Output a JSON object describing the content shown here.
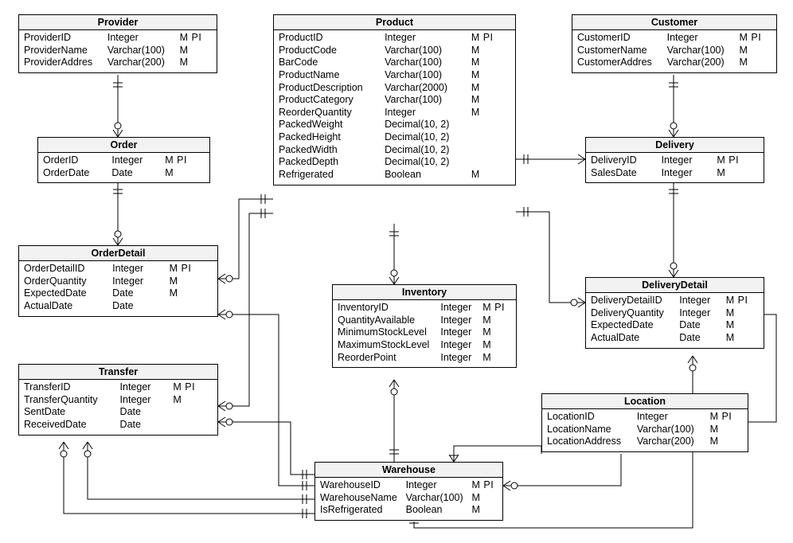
{
  "entities": {
    "provider": {
      "title": "Provider",
      "attrs": [
        {
          "name": "ProviderID",
          "type": "Integer",
          "flags": "M PI"
        },
        {
          "name": "ProviderName",
          "type": "Varchar(100)",
          "flags": "M"
        },
        {
          "name": "ProviderAddres",
          "type": "Varchar(200)",
          "flags": "M"
        }
      ]
    },
    "order": {
      "title": "Order",
      "attrs": [
        {
          "name": "OrderID",
          "type": "Integer",
          "flags": "M PI"
        },
        {
          "name": "OrderDate",
          "type": "Date",
          "flags": "M"
        }
      ]
    },
    "orderdetail": {
      "title": "OrderDetail",
      "attrs": [
        {
          "name": "OrderDetailID",
          "type": "Integer",
          "flags": "M PI"
        },
        {
          "name": "OrderQuantity",
          "type": "Integer",
          "flags": "M"
        },
        {
          "name": "ExpectedDate",
          "type": "Date",
          "flags": "M"
        },
        {
          "name": "ActualDate",
          "type": "Date",
          "flags": ""
        }
      ]
    },
    "transfer": {
      "title": "Transfer",
      "attrs": [
        {
          "name": "TransferID",
          "type": "Integer",
          "flags": "M PI"
        },
        {
          "name": "TransferQuantity",
          "type": "Integer",
          "flags": "M"
        },
        {
          "name": "SentDate",
          "type": "Date",
          "flags": ""
        },
        {
          "name": "ReceivedDate",
          "type": "Date",
          "flags": ""
        }
      ]
    },
    "product": {
      "title": "Product",
      "attrs": [
        {
          "name": "ProductID",
          "type": "Integer",
          "flags": "M PI"
        },
        {
          "name": "ProductCode",
          "type": "Varchar(100)",
          "flags": "M"
        },
        {
          "name": "BarCode",
          "type": "Varchar(100)",
          "flags": "M"
        },
        {
          "name": "ProductName",
          "type": "Varchar(100)",
          "flags": "M"
        },
        {
          "name": "ProductDescription",
          "type": "Varchar(2000)",
          "flags": "M"
        },
        {
          "name": "ProductCategory",
          "type": "Varchar(100)",
          "flags": "M"
        },
        {
          "name": "ReorderQuantity",
          "type": "Integer",
          "flags": "M"
        },
        {
          "name": "PackedWeight",
          "type": "Decimal(10, 2)",
          "flags": ""
        },
        {
          "name": "PackedHeight",
          "type": "Decimal(10, 2)",
          "flags": ""
        },
        {
          "name": "PackedWidth",
          "type": "Decimal(10, 2)",
          "flags": ""
        },
        {
          "name": "PackedDepth",
          "type": "Decimal(10, 2)",
          "flags": ""
        },
        {
          "name": "Refrigerated",
          "type": "Boolean",
          "flags": "M"
        }
      ]
    },
    "inventory": {
      "title": "Inventory",
      "attrs": [
        {
          "name": "InventoryID",
          "type": "Integer",
          "flags": "M PI"
        },
        {
          "name": "QuantityAvailable",
          "type": "Integer",
          "flags": "M"
        },
        {
          "name": "MinimumStockLevel",
          "type": "Integer",
          "flags": "M"
        },
        {
          "name": "MaximumStockLevel",
          "type": "Integer",
          "flags": "M"
        },
        {
          "name": "ReorderPoint",
          "type": "Integer",
          "flags": "M"
        }
      ]
    },
    "warehouse": {
      "title": "Warehouse",
      "attrs": [
        {
          "name": "WarehouseID",
          "type": "Integer",
          "flags": "M PI"
        },
        {
          "name": "WarehouseName",
          "type": "Varchar(100)",
          "flags": "M"
        },
        {
          "name": "IsRefrigerated",
          "type": "Boolean",
          "flags": "M"
        }
      ]
    },
    "customer": {
      "title": "Customer",
      "attrs": [
        {
          "name": "CustomerID",
          "type": "Integer",
          "flags": "M PI"
        },
        {
          "name": "CustomerName",
          "type": "Varchar(100)",
          "flags": "M"
        },
        {
          "name": "CustomerAddres",
          "type": "Varchar(200)",
          "flags": "M"
        }
      ]
    },
    "delivery": {
      "title": "Delivery",
      "attrs": [
        {
          "name": "DeliveryID",
          "type": "Integer",
          "flags": "M PI"
        },
        {
          "name": "SalesDate",
          "type": "Integer",
          "flags": "M"
        }
      ]
    },
    "deliverydetail": {
      "title": "DeliveryDetail",
      "attrs": [
        {
          "name": "DeliveryDetailID",
          "type": "Integer",
          "flags": "M PI"
        },
        {
          "name": "DeliveryQuantity",
          "type": "Integer",
          "flags": "M"
        },
        {
          "name": "ExpectedDate",
          "type": "Date",
          "flags": "M"
        },
        {
          "name": "ActualDate",
          "type": "Date",
          "flags": "M"
        }
      ]
    },
    "location": {
      "title": "Location",
      "attrs": [
        {
          "name": "LocationID",
          "type": "Integer",
          "flags": "M PI"
        },
        {
          "name": "LocationName",
          "type": "Varchar(100)",
          "flags": "M"
        },
        {
          "name": "LocationAddress",
          "type": "Varchar(200)",
          "flags": "M"
        }
      ]
    }
  }
}
